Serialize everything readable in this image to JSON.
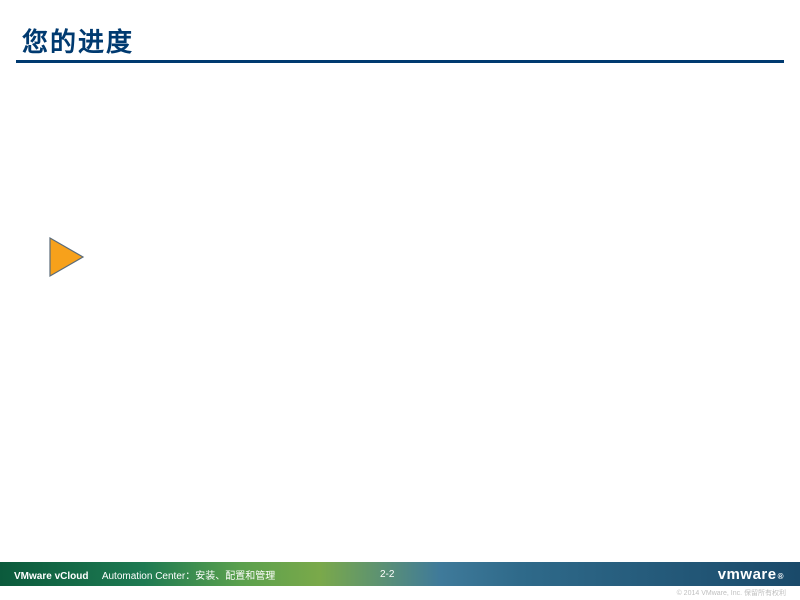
{
  "title": "您的进度",
  "footer": {
    "product_bold": "VMware vCloud",
    "product_rest": "Automation Center：安装、配置和管理",
    "page": "2-2",
    "logo_text": "vmware",
    "logo_reg": "®"
  },
  "copyright": "© 2014 VMware, Inc. 保留所有权利",
  "colors": {
    "title": "#003a70",
    "arrow_fill": "#f7a11b",
    "arrow_stroke": "#5a6b7a"
  }
}
